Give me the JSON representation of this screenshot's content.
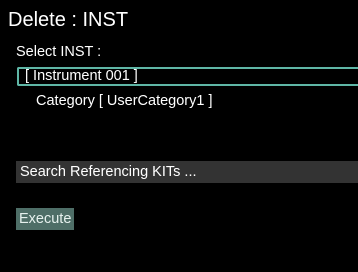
{
  "screen": {
    "title": "Delete : INST",
    "select_label": "Select INST :",
    "instrument_value": "[ Instrument 001 ]",
    "category_text": "Category [ UserCategory1 ]",
    "search_text": "Search Referencing KITs ...",
    "execute_label": "Execute"
  },
  "colors": {
    "background": "#000000",
    "focus_border": "#5fb6a6",
    "search_bar": "#333333",
    "execute_button": "#4e6e67"
  }
}
